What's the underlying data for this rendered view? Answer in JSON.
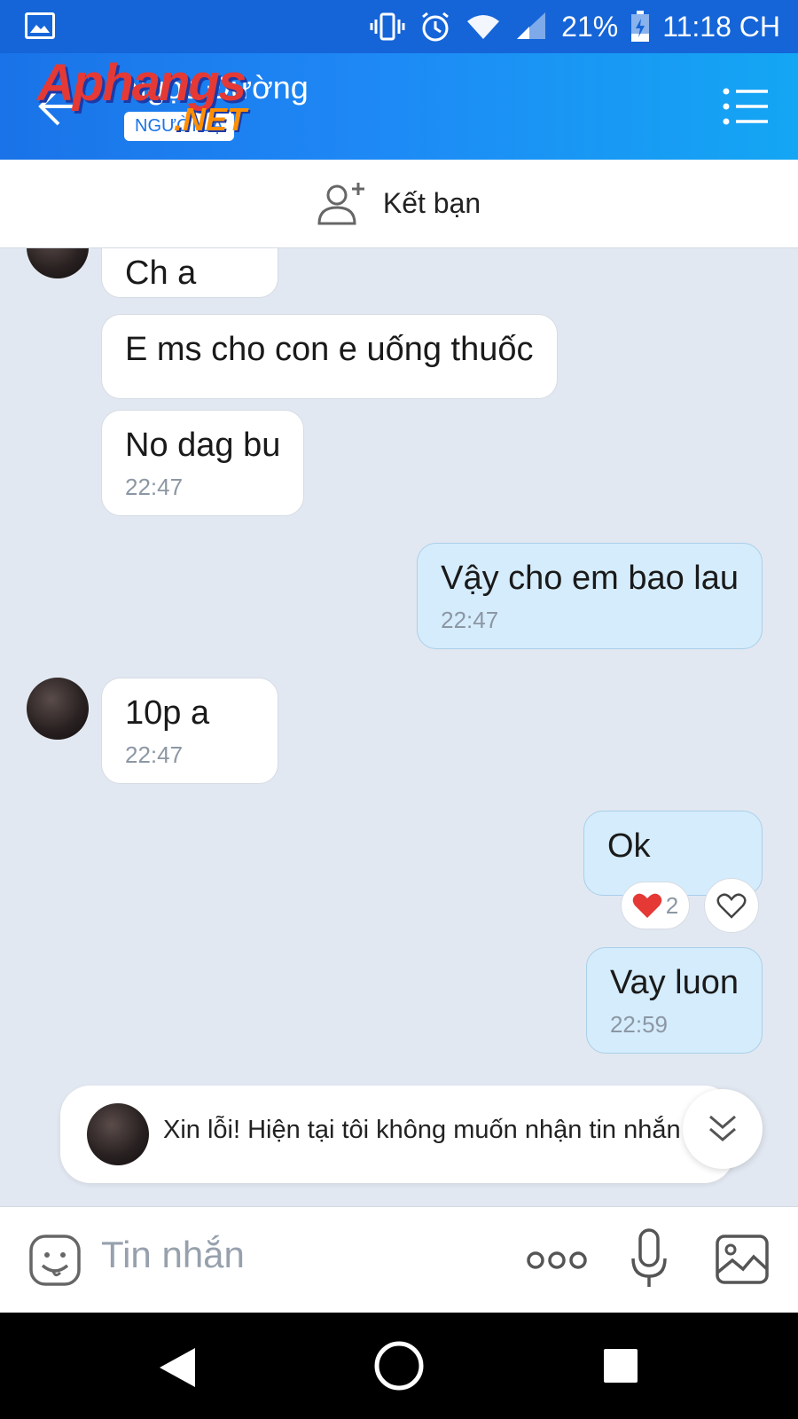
{
  "status_bar": {
    "battery": "21%",
    "time": "11:18 CH"
  },
  "header": {
    "contact_name": "Ngọc Đường",
    "contact_tag": "NGƯỜI LẠ",
    "watermark": "Aphangs",
    "watermark_suffix": ".NET"
  },
  "add_friend": {
    "label": "Kết bạn"
  },
  "messages": [
    {
      "direction": "in",
      "text": "Ch a",
      "time": ""
    },
    {
      "direction": "in",
      "text": "E ms cho con e uống thuốc",
      "time": ""
    },
    {
      "direction": "in",
      "text": "No dag bu",
      "time": "22:47"
    },
    {
      "direction": "out",
      "text": "Vậy cho em bao lau",
      "time": "22:47"
    },
    {
      "direction": "in",
      "text": "10p a",
      "time": "22:47"
    },
    {
      "direction": "out",
      "text": "Ok",
      "time": "",
      "reaction_count": "2"
    },
    {
      "direction": "out",
      "text": "Vay luon",
      "time": "22:59"
    }
  ],
  "auto_reply": {
    "text": "Xin lỗi! Hiện tại tôi không muốn nhận tin nhắn"
  },
  "composer": {
    "placeholder": "Tin nhắn"
  },
  "colors": {
    "header_blue": "#1a73e8",
    "chat_background": "#e2e8f1",
    "outgoing_bubble": "#d5ecfc",
    "reaction_heart": "#e53935"
  }
}
